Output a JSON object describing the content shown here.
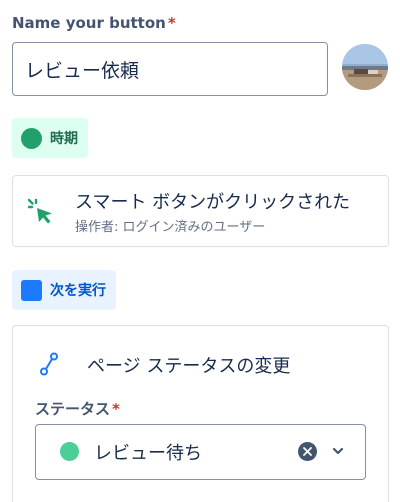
{
  "form": {
    "name_label": "Name your button",
    "required_mark": "*",
    "name_value": "レビュー依頼"
  },
  "when": {
    "chip_label": "時期",
    "trigger_title": "スマート ボタンがクリックされた",
    "trigger_subtitle": "操作者: ログイン済みのユーザー"
  },
  "then": {
    "chip_label": "次を実行",
    "action_title": "ページ ステータスの変更",
    "status_label": "ステータス",
    "required_mark": "*",
    "status_value": "レビュー待ち"
  },
  "colors": {
    "when_accent": "#22a06b",
    "then_accent": "#1d7afc",
    "status_dot": "#4bce97",
    "required": "#c9372c"
  },
  "icons": {
    "trigger": "cursor-click-icon",
    "action": "flow-route-icon",
    "clear": "clear-x-icon",
    "dropdown": "chevron-down-icon"
  }
}
